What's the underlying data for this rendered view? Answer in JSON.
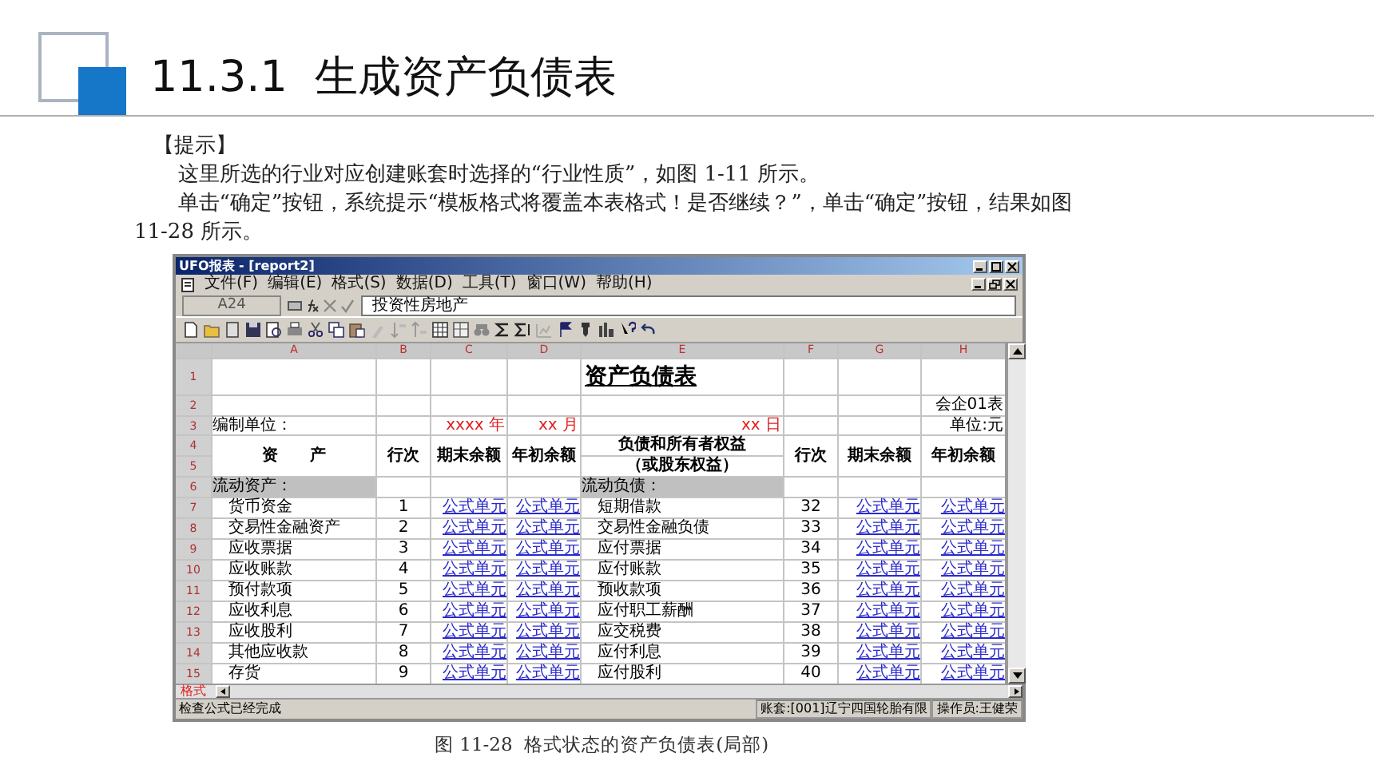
{
  "slide": {
    "title": "11.3.1  生成资产负债表"
  },
  "hint": {
    "heading": "【提示】",
    "paragraphs": [
      "这里所选的行业对应创建账套时选择的“行业性质”，如图 1-11 所示。",
      "单击“确定”按钮，系统提示“模板格式将覆盖本表格式！是否继续？”，单击“确定”按钮，结果如图 11-28 所示。"
    ]
  },
  "window": {
    "title": "UFO报表 - [report2]",
    "menu": [
      "文件(F)",
      "编辑(E)",
      "格式(S)",
      "数据(D)",
      "工具(T)",
      "窗口(W)",
      "帮助(H)"
    ],
    "formula_bar": {
      "cell": "A24",
      "value": "投资性房地产"
    },
    "columns": [
      "A",
      "B",
      "C",
      "D",
      "E",
      "F",
      "G",
      "H"
    ],
    "row_numbers": [
      "1",
      "2",
      "3",
      "4",
      "5",
      "6",
      "7",
      "8",
      "9",
      "10",
      "11",
      "12",
      "13",
      "14",
      "15"
    ],
    "sheet": {
      "title": "资产负债表",
      "form_no": "会企01表",
      "compiler_label": "编制单位：",
      "year": "xxxx 年",
      "month": "xx 月",
      "day": "xx 日",
      "unit": "单位:元",
      "header": {
        "assets": "资　　产",
        "line": "行次",
        "closing": "期末余额",
        "opening": "年初余额",
        "liabilities": "负债和所有者权益",
        "liabilities_sub": "（或股东权益）",
        "line_2": "行次",
        "closing_2": "期末余额",
        "opening_2": "年初余额"
      },
      "section": {
        "assets": "流动资产：",
        "liabilities": "流动负债："
      },
      "rows": [
        {
          "asset": "货币资金",
          "line": "1",
          "closing": "公式单元",
          "opening": "公式单元",
          "liability": "短期借款",
          "line_2": "32",
          "closing_2": "公式单元",
          "opening_2": "公式单元"
        },
        {
          "asset": "交易性金融资产",
          "line": "2",
          "closing": "公式单元",
          "opening": "公式单元",
          "liability": "交易性金融负债",
          "line_2": "33",
          "closing_2": "公式单元",
          "opening_2": "公式单元"
        },
        {
          "asset": "应收票据",
          "line": "3",
          "closing": "公式单元",
          "opening": "公式单元",
          "liability": "应付票据",
          "line_2": "34",
          "closing_2": "公式单元",
          "opening_2": "公式单元"
        },
        {
          "asset": "应收账款",
          "line": "4",
          "closing": "公式单元",
          "opening": "公式单元",
          "liability": "应付账款",
          "line_2": "35",
          "closing_2": "公式单元",
          "opening_2": "公式单元"
        },
        {
          "asset": "预付款项",
          "line": "5",
          "closing": "公式单元",
          "opening": "公式单元",
          "liability": "预收款项",
          "line_2": "36",
          "closing_2": "公式单元",
          "opening_2": "公式单元"
        },
        {
          "asset": "应收利息",
          "line": "6",
          "closing": "公式单元",
          "opening": "公式单元",
          "liability": "应付职工薪酬",
          "line_2": "37",
          "closing_2": "公式单元",
          "opening_2": "公式单元"
        },
        {
          "asset": "应收股利",
          "line": "7",
          "closing": "公式单元",
          "opening": "公式单元",
          "liability": "应交税费",
          "line_2": "38",
          "closing_2": "公式单元",
          "opening_2": "公式单元"
        },
        {
          "asset": "其他应收款",
          "line": "8",
          "closing": "公式单元",
          "opening": "公式单元",
          "liability": "应付利息",
          "line_2": "39",
          "closing_2": "公式单元",
          "opening_2": "公式单元"
        },
        {
          "asset": "存货",
          "line": "9",
          "closing": "公式单元",
          "opening": "公式单元",
          "liability": "应付股利",
          "line_2": "40",
          "closing_2": "公式单元",
          "opening_2": "公式单元"
        }
      ]
    },
    "sheet_tab": "格式",
    "status_bar": {
      "message": "检查公式已经完成",
      "account": "账套:[001]辽宁四国轮胎有限",
      "operator": "操作员:王健荣"
    }
  },
  "caption": "图 11-28  格式状态的资产负债表(局部)"
}
